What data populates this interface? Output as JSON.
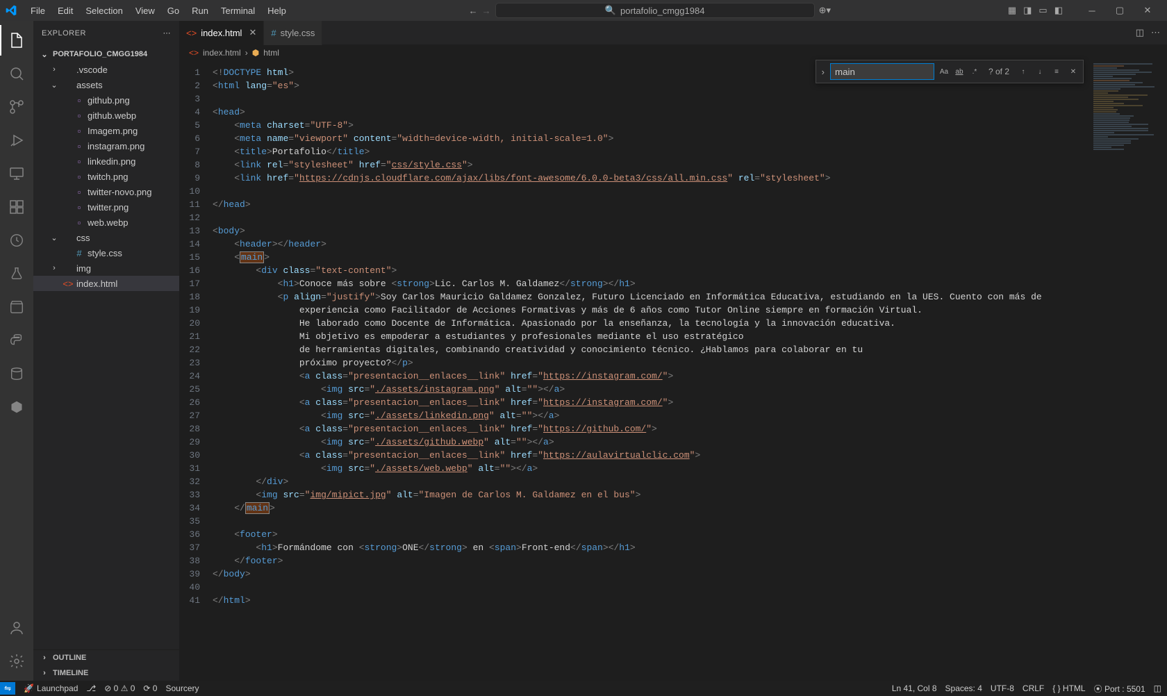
{
  "title_bar": {
    "menu": [
      "File",
      "Edit",
      "Selection",
      "View",
      "Go",
      "Run",
      "Terminal",
      "Help"
    ],
    "search_text": "portafolio_cmgg1984"
  },
  "sidebar": {
    "header": "EXPLORER",
    "root": "PORTAFOLIO_CMGG1984",
    "tree": [
      {
        "type": "folder",
        "name": ".vscode",
        "depth": 1,
        "open": false
      },
      {
        "type": "folder",
        "name": "assets",
        "depth": 1,
        "open": true
      },
      {
        "type": "file",
        "name": "github.png",
        "depth": 2,
        "icon": "image"
      },
      {
        "type": "file",
        "name": "github.webp",
        "depth": 2,
        "icon": "image"
      },
      {
        "type": "file",
        "name": "Imagem.png",
        "depth": 2,
        "icon": "image"
      },
      {
        "type": "file",
        "name": "instagram.png",
        "depth": 2,
        "icon": "image"
      },
      {
        "type": "file",
        "name": "linkedin.png",
        "depth": 2,
        "icon": "image"
      },
      {
        "type": "file",
        "name": "twitch.png",
        "depth": 2,
        "icon": "image"
      },
      {
        "type": "file",
        "name": "twitter-novo.png",
        "depth": 2,
        "icon": "image"
      },
      {
        "type": "file",
        "name": "twitter.png",
        "depth": 2,
        "icon": "image"
      },
      {
        "type": "file",
        "name": "web.webp",
        "depth": 2,
        "icon": "image"
      },
      {
        "type": "folder",
        "name": "css",
        "depth": 1,
        "open": true
      },
      {
        "type": "file",
        "name": "style.css",
        "depth": 2,
        "icon": "css"
      },
      {
        "type": "folder",
        "name": "img",
        "depth": 1,
        "open": false
      },
      {
        "type": "file",
        "name": "index.html",
        "depth": 1,
        "icon": "html",
        "selected": true
      }
    ],
    "collapsed": [
      "OUTLINE",
      "TIMELINE"
    ]
  },
  "tabs": [
    {
      "label": "index.html",
      "icon": "html",
      "active": true,
      "dirty": false,
      "close": true
    },
    {
      "label": "style.css",
      "icon": "css",
      "active": false
    }
  ],
  "breadcrumb": [
    "index.html",
    "html"
  ],
  "find": {
    "value": "main",
    "result": "? of 2"
  },
  "line_count": 41,
  "status": {
    "left": [
      {
        "icon": "remote",
        "text": ""
      },
      {
        "icon": "rocket",
        "text": "Launchpad"
      },
      {
        "icon": "branch",
        "text": ""
      },
      {
        "icon": "warn",
        "text": "0"
      },
      {
        "icon": "warn2",
        "text": "0"
      },
      {
        "icon": "port",
        "text": "0"
      },
      {
        "icon": "",
        "text": "Sourcery"
      }
    ],
    "right": [
      "Ln 41, Col 8",
      "Spaces: 4",
      "UTF-8",
      "CRLF",
      "{ } HTML",
      "⦿ Port : 5501",
      "◫"
    ]
  },
  "minimap_lines": 42
}
